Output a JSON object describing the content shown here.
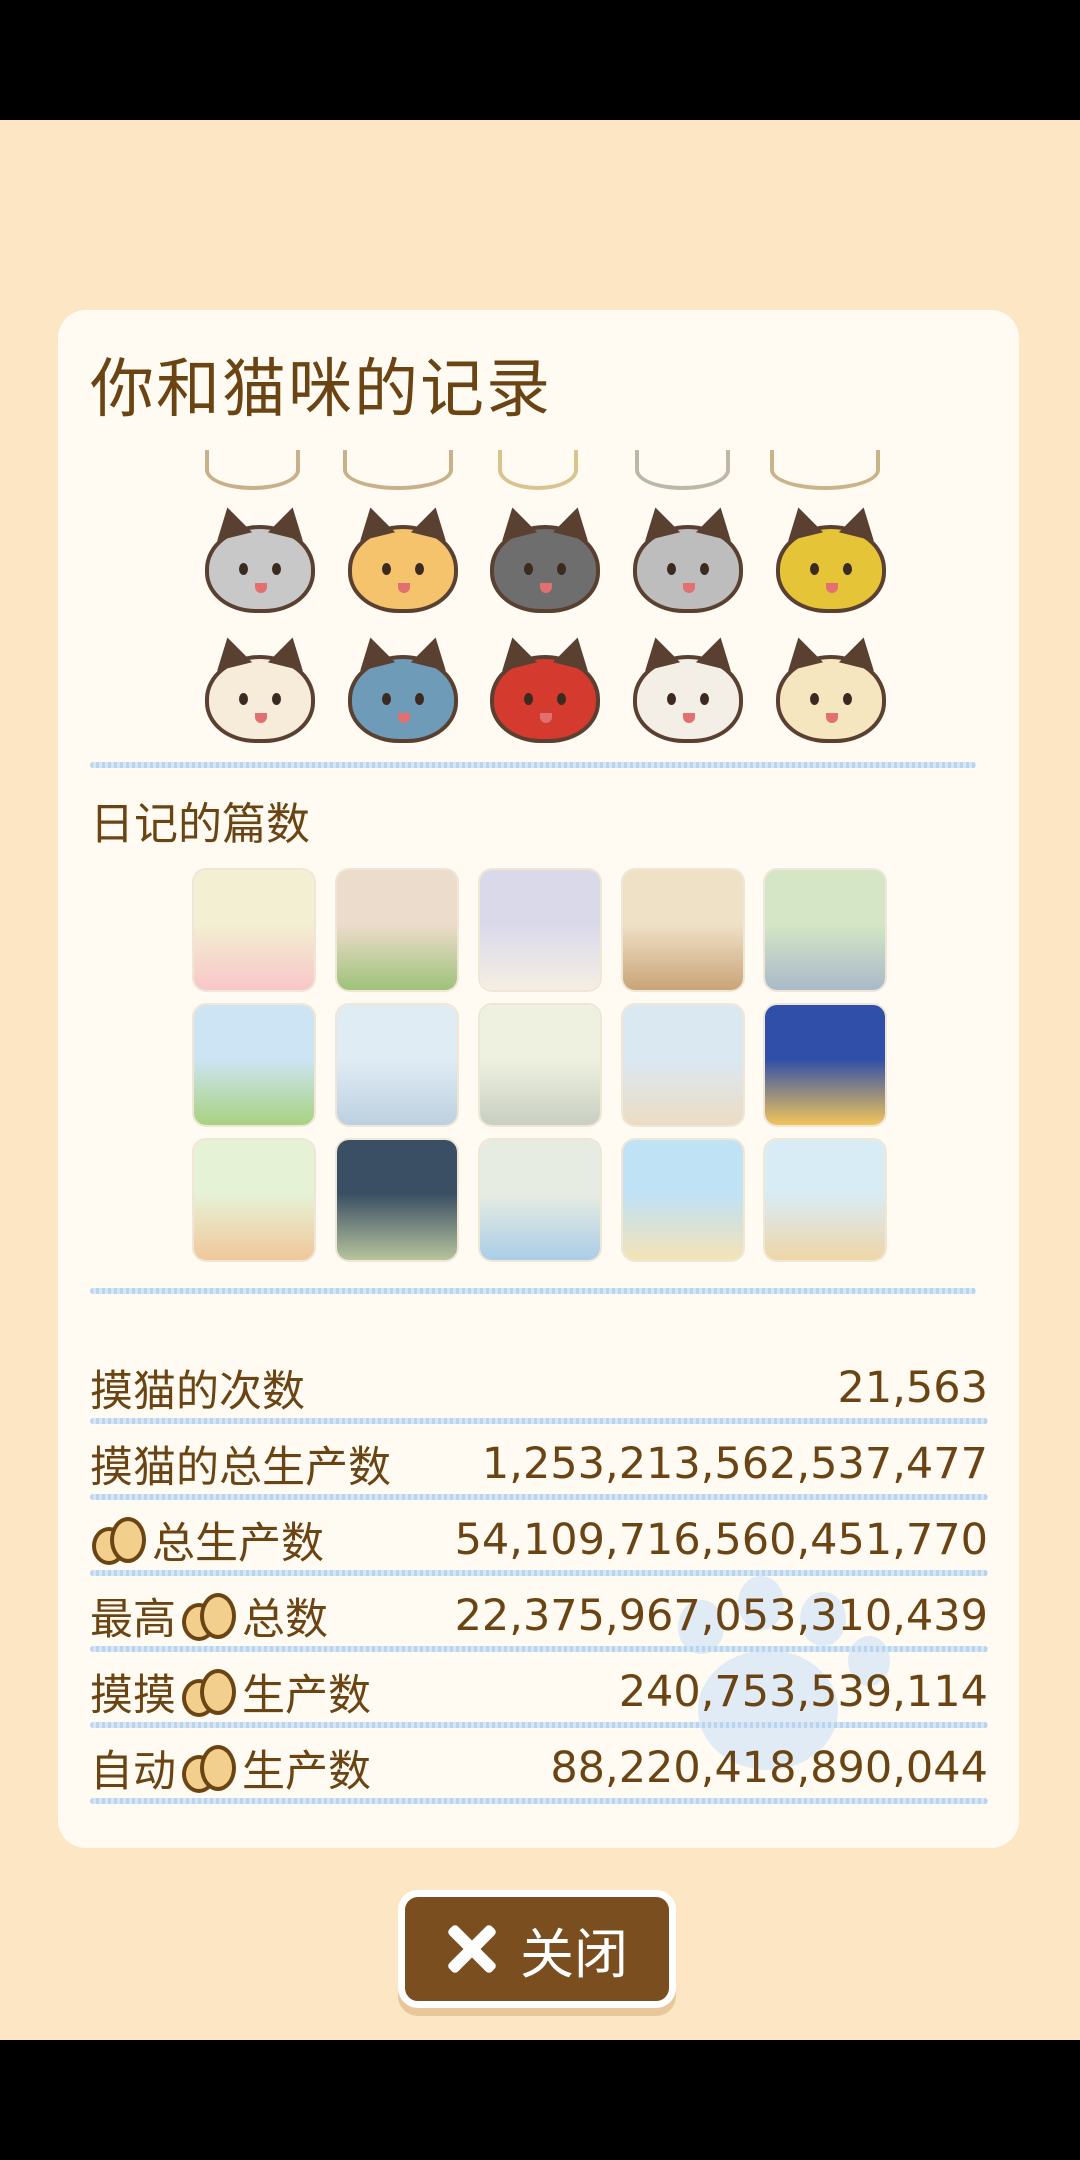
{
  "dialog": {
    "title": "你和猫咪的记录",
    "diary_label": "日记的篇数",
    "close_label": "关闭"
  },
  "cat_faces": [
    {
      "name": "cat-grey-whiskered",
      "color": "#c8c8c8"
    },
    {
      "name": "cat-orange",
      "color": "#f4c36b"
    },
    {
      "name": "cat-dark-grey",
      "color": "#6e6e6e"
    },
    {
      "name": "cat-grey-tabby",
      "color": "#bdbdbd"
    },
    {
      "name": "cat-golden",
      "color": "#e6c437"
    },
    {
      "name": "cat-calico",
      "color": "#f6ecd9"
    },
    {
      "name": "cat-blue-white",
      "color": "#6d9bb8"
    },
    {
      "name": "cat-red-masked",
      "color": "#d43a2e"
    },
    {
      "name": "cat-white",
      "color": "#f4efe6"
    },
    {
      "name": "cat-crowned-longhair",
      "color": "#f6e6bf"
    }
  ],
  "diary_thumbs": [
    {
      "name": "thumb-paw-colors",
      "colors": [
        "#f3efd2",
        "#f8c6c9"
      ]
    },
    {
      "name": "thumb-cats-in-room",
      "colors": [
        "#ecdccb",
        "#9ec27a"
      ]
    },
    {
      "name": "thumb-bed",
      "colors": [
        "#d9d9ea",
        "#f6efe4"
      ]
    },
    {
      "name": "thumb-cat-tower",
      "colors": [
        "#efe1c6",
        "#c9a478"
      ]
    },
    {
      "name": "thumb-pond",
      "colors": [
        "#d5e6c6",
        "#a9b9c9"
      ]
    },
    {
      "name": "thumb-house",
      "colors": [
        "#cde4f4",
        "#a8d27f"
      ]
    },
    {
      "name": "thumb-city-ruins",
      "colors": [
        "#e0ecf4",
        "#bcd0e0"
      ]
    },
    {
      "name": "thumb-tower-light",
      "colors": [
        "#eef1df",
        "#c8cfc2"
      ]
    },
    {
      "name": "thumb-pyramid-cat",
      "colors": [
        "#dae8f2",
        "#ecdcc4"
      ]
    },
    {
      "name": "thumb-space-cat",
      "colors": [
        "#2f4fa8",
        "#f2c55a"
      ]
    },
    {
      "name": "thumb-rolling-cats",
      "colors": [
        "#e6f2d6",
        "#f0c79a"
      ]
    },
    {
      "name": "thumb-night-tree",
      "colors": [
        "#3b4f64",
        "#b7c49d"
      ]
    },
    {
      "name": "thumb-safety-first",
      "colors": [
        "#e7ece2",
        "#aacde6"
      ]
    },
    {
      "name": "thumb-beach",
      "colors": [
        "#bfe2f5",
        "#f4e3b6"
      ]
    },
    {
      "name": "thumb-castle-cats",
      "colors": [
        "#d8ecf5",
        "#eed6a6"
      ]
    }
  ],
  "stats": [
    {
      "label": "摸猫的次数",
      "icon_before": false,
      "label_prefix": "",
      "value": "21,563"
    },
    {
      "label": "摸猫的总生产数",
      "icon_before": false,
      "label_prefix": "",
      "value": "1,253,213,562,537,477"
    },
    {
      "label": "总生产数",
      "icon_before": true,
      "label_prefix": "",
      "value": "54,109,716,560,451,770"
    },
    {
      "label": "总数",
      "icon_before": true,
      "label_prefix": "最高",
      "value": "22,375,967,053,310,439"
    },
    {
      "label": "生产数",
      "icon_before": true,
      "label_prefix": "摸摸",
      "value": "240,753,539,114"
    },
    {
      "label": "生产数",
      "icon_before": true,
      "label_prefix": "自动",
      "value": "88,220,418,890,044"
    }
  ],
  "icons": {
    "bun": "bun-icon",
    "close": "close-icon"
  },
  "colors": {
    "background": "#fde6c4",
    "panel": "#fffbf2",
    "text": "#6b4414",
    "button": "#7a4e1e"
  }
}
